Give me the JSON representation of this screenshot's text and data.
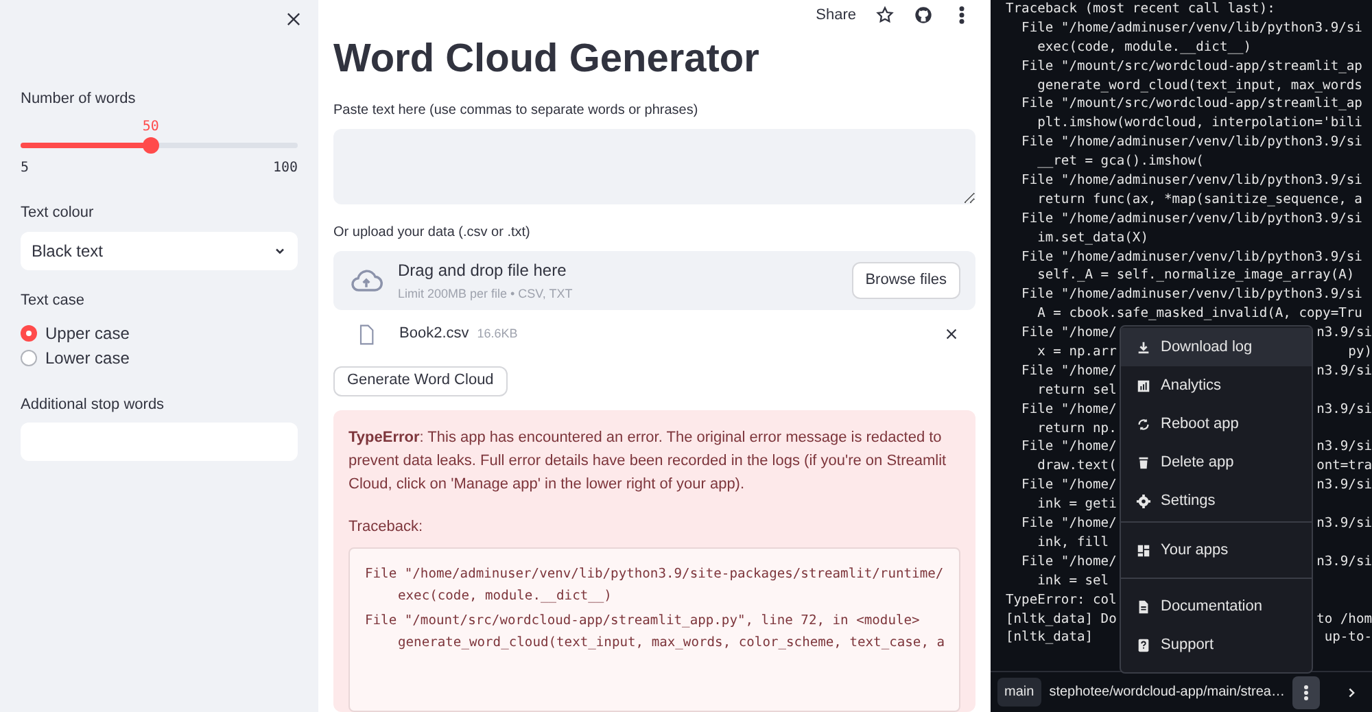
{
  "sidebar": {
    "slider": {
      "label": "Number of words",
      "value": "50",
      "min": "5",
      "max": "100",
      "level": 0.47
    },
    "select": {
      "label": "Text colour",
      "value": "Black text"
    },
    "radio": {
      "label": "Text case",
      "options": [
        {
          "label": "Upper case",
          "selected": true
        },
        {
          "label": "Lower case",
          "selected": false
        }
      ]
    },
    "stop_words": {
      "label": "Additional stop words"
    }
  },
  "main": {
    "toolbar": {
      "share": "Share"
    },
    "title": "Word Cloud Generator",
    "text_area": {
      "label": "Paste text here (use commas to separate words or phrases)"
    },
    "uploader": {
      "label": "Or upload your data (.csv or .txt)",
      "prompt": "Drag and drop file here",
      "limit": "Limit 200MB per file • CSV, TXT",
      "button": "Browse files"
    },
    "file": {
      "name": "Book2.csv",
      "size": "16.6KB"
    },
    "button": "Generate Word Cloud",
    "error": {
      "message": "**TypeError**: This app has encountered an error. The original error message is redacted to prevent data leaks. Full error details have been recorded in the logs (if you're on Streamlit Cloud, click on 'Manage app' in the lower right of your app).",
      "traceback_label": "Traceback:",
      "code": [
        {
          "file": "File \"/home/adminuser/venv/lib/python3.9/site-packages/streamlit/runtime/",
          "call": "exec(code, module.__dict__)"
        },
        {
          "file": "File \"/mount/src/wordcloud-app/streamlit_app.py\", line 72, in <module>",
          "call": "generate_word_cloud(text_input, max_words, color_scheme, text_case, a"
        }
      ]
    }
  },
  "log": {
    "lines": [
      {
        "left": "Traceback (most recent call last):"
      },
      {
        "left": "  File \"/home/adminuser/venv/lib/python3.9/si"
      },
      {
        "left": "    exec(code, module.__dict__)"
      },
      {
        "left": "  File \"/mount/src/wordcloud-app/streamlit_ap"
      },
      {
        "left": "    generate_word_cloud(text_input, max_words"
      },
      {
        "left": "  File \"/mount/src/wordcloud-app/streamlit_ap"
      },
      {
        "left": "    plt.imshow(wordcloud, interpolation='bili"
      },
      {
        "left": "  File \"/home/adminuser/venv/lib/python3.9/si"
      },
      {
        "left": "    __ret = gca().imshow("
      },
      {
        "left": "  File \"/home/adminuser/venv/lib/python3.9/si"
      },
      {
        "left": "    return func(ax, *map(sanitize_sequence, a"
      },
      {
        "left": "  File \"/home/adminuser/venv/lib/python3.9/si"
      },
      {
        "left": "    im.set_data(X)"
      },
      {
        "left": "  File \"/home/adminuser/venv/lib/python3.9/si"
      },
      {
        "left": "    self._A = self._normalize_image_array(A)"
      },
      {
        "left": "  File \"/home/adminuser/venv/lib/python3.9/si"
      },
      {
        "left": "    A = cbook.safe_masked_invalid(A, copy=Tru"
      },
      {
        "left": "  File \"/home/",
        "right": "n3.9/si"
      },
      {
        "left": "    x = np.arr",
        "right": "py)"
      },
      {
        "left": "  File \"/home/",
        "right": "n3.9/si"
      },
      {
        "left": "    return sel"
      },
      {
        "left": "  File \"/home/",
        "right": "n3.9/si"
      },
      {
        "left": "    return np."
      },
      {
        "left": "  File \"/home/",
        "right": "n3.9/si"
      },
      {
        "left": "    draw.text(",
        "right": "ont=tra"
      },
      {
        "left": "  File \"/home/",
        "right": "n3.9/si"
      },
      {
        "left": "    ink = geti"
      },
      {
        "left": "  File \"/home/",
        "right": "n3.9/si"
      },
      {
        "left": "    ink, fill"
      },
      {
        "left": "  File \"/home/",
        "right": "n3.9/si"
      },
      {
        "left": "    ink = sel"
      },
      {
        "left": "TypeError: col"
      },
      {
        "left": "[nltk_data] Do",
        "right": "to /hom"
      },
      {
        "left": "[nltk_data]",
        "right": "up-to-"
      }
    ],
    "menu": [
      [
        {
          "label": "Download log",
          "selected": true
        },
        {
          "label": "Analytics",
          "selected": false
        },
        {
          "label": "Reboot app",
          "selected": false
        },
        {
          "label": "Delete app",
          "selected": false
        },
        {
          "label": "Settings",
          "selected": false
        }
      ],
      [
        {
          "label": "Your apps",
          "selected": false
        }
      ],
      [
        {
          "label": "Documentation",
          "selected": false
        },
        {
          "label": "Support",
          "selected": false
        }
      ]
    ],
    "footer": {
      "branch": "main",
      "path": "stephotee/wordcloud-app/main/strea…"
    }
  }
}
